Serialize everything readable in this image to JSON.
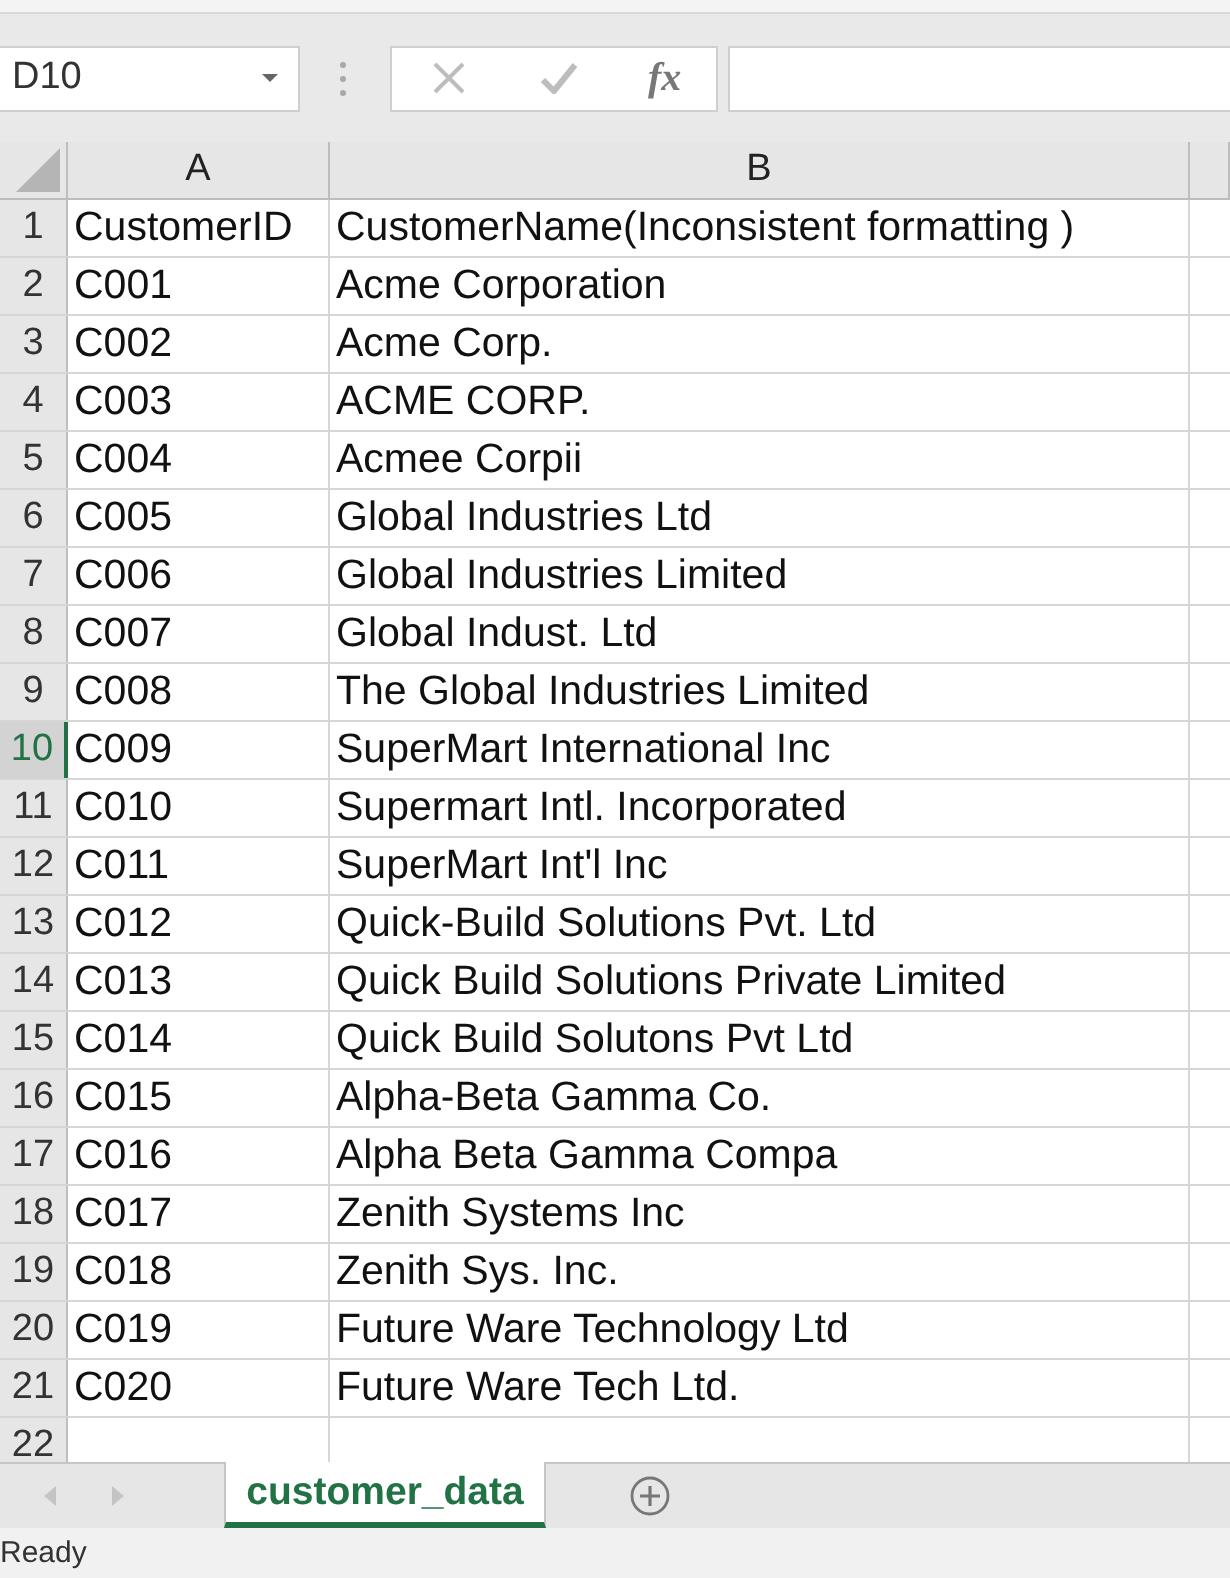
{
  "formula_bar": {
    "name_box": "D10",
    "function_label": "fx"
  },
  "columns": [
    {
      "label": "A"
    },
    {
      "label": "B"
    }
  ],
  "rows": [
    {
      "number": "1",
      "selected": false,
      "cells": [
        "CustomerID",
        "CustomerName(Inconsistent formatting )"
      ]
    },
    {
      "number": "2",
      "selected": false,
      "cells": [
        "C001",
        "Acme Corporation"
      ]
    },
    {
      "number": "3",
      "selected": false,
      "cells": [
        "C002",
        "Acme Corp."
      ]
    },
    {
      "number": "4",
      "selected": false,
      "cells": [
        "C003",
        "ACME CORP."
      ]
    },
    {
      "number": "5",
      "selected": false,
      "cells": [
        "C004",
        "Acmee Corpii"
      ]
    },
    {
      "number": "6",
      "selected": false,
      "cells": [
        "C005",
        "Global Industries Ltd"
      ]
    },
    {
      "number": "7",
      "selected": false,
      "cells": [
        "C006",
        "Global Industries Limited"
      ]
    },
    {
      "number": "8",
      "selected": false,
      "cells": [
        "C007",
        "Global Indust. Ltd"
      ]
    },
    {
      "number": "9",
      "selected": false,
      "cells": [
        "C008",
        "The Global Industries Limited"
      ]
    },
    {
      "number": "10",
      "selected": true,
      "cells": [
        "C009",
        "SuperMart International Inc"
      ]
    },
    {
      "number": "11",
      "selected": false,
      "cells": [
        "C010",
        "Supermart Intl. Incorporated"
      ]
    },
    {
      "number": "12",
      "selected": false,
      "cells": [
        "C011",
        "SuperMart Int'l Inc"
      ]
    },
    {
      "number": "13",
      "selected": false,
      "cells": [
        "C012",
        "Quick-Build Solutions Pvt. Ltd"
      ]
    },
    {
      "number": "14",
      "selected": false,
      "cells": [
        "C013",
        "Quick Build Solutions Private Limited"
      ]
    },
    {
      "number": "15",
      "selected": false,
      "cells": [
        "C014",
        "Quick Build Solutons Pvt Ltd"
      ]
    },
    {
      "number": "16",
      "selected": false,
      "cells": [
        "C015",
        "Alpha-Beta Gamma Co."
      ]
    },
    {
      "number": "17",
      "selected": false,
      "cells": [
        "C016",
        "Alpha Beta Gamma Compa"
      ]
    },
    {
      "number": "18",
      "selected": false,
      "cells": [
        "C017",
        "Zenith Systems Inc"
      ]
    },
    {
      "number": "19",
      "selected": false,
      "cells": [
        "C018",
        "Zenith Sys. Inc."
      ]
    },
    {
      "number": "20",
      "selected": false,
      "cells": [
        "C019",
        "Future Ware Technology Ltd"
      ]
    },
    {
      "number": "21",
      "selected": false,
      "cells": [
        "C020",
        "Future Ware Tech Ltd."
      ]
    },
    {
      "number": "22",
      "selected": false
    }
  ],
  "sheet_tabs": [
    {
      "label": "customer_data",
      "selected": true
    }
  ],
  "status_bar": {
    "text": "Ready"
  }
}
